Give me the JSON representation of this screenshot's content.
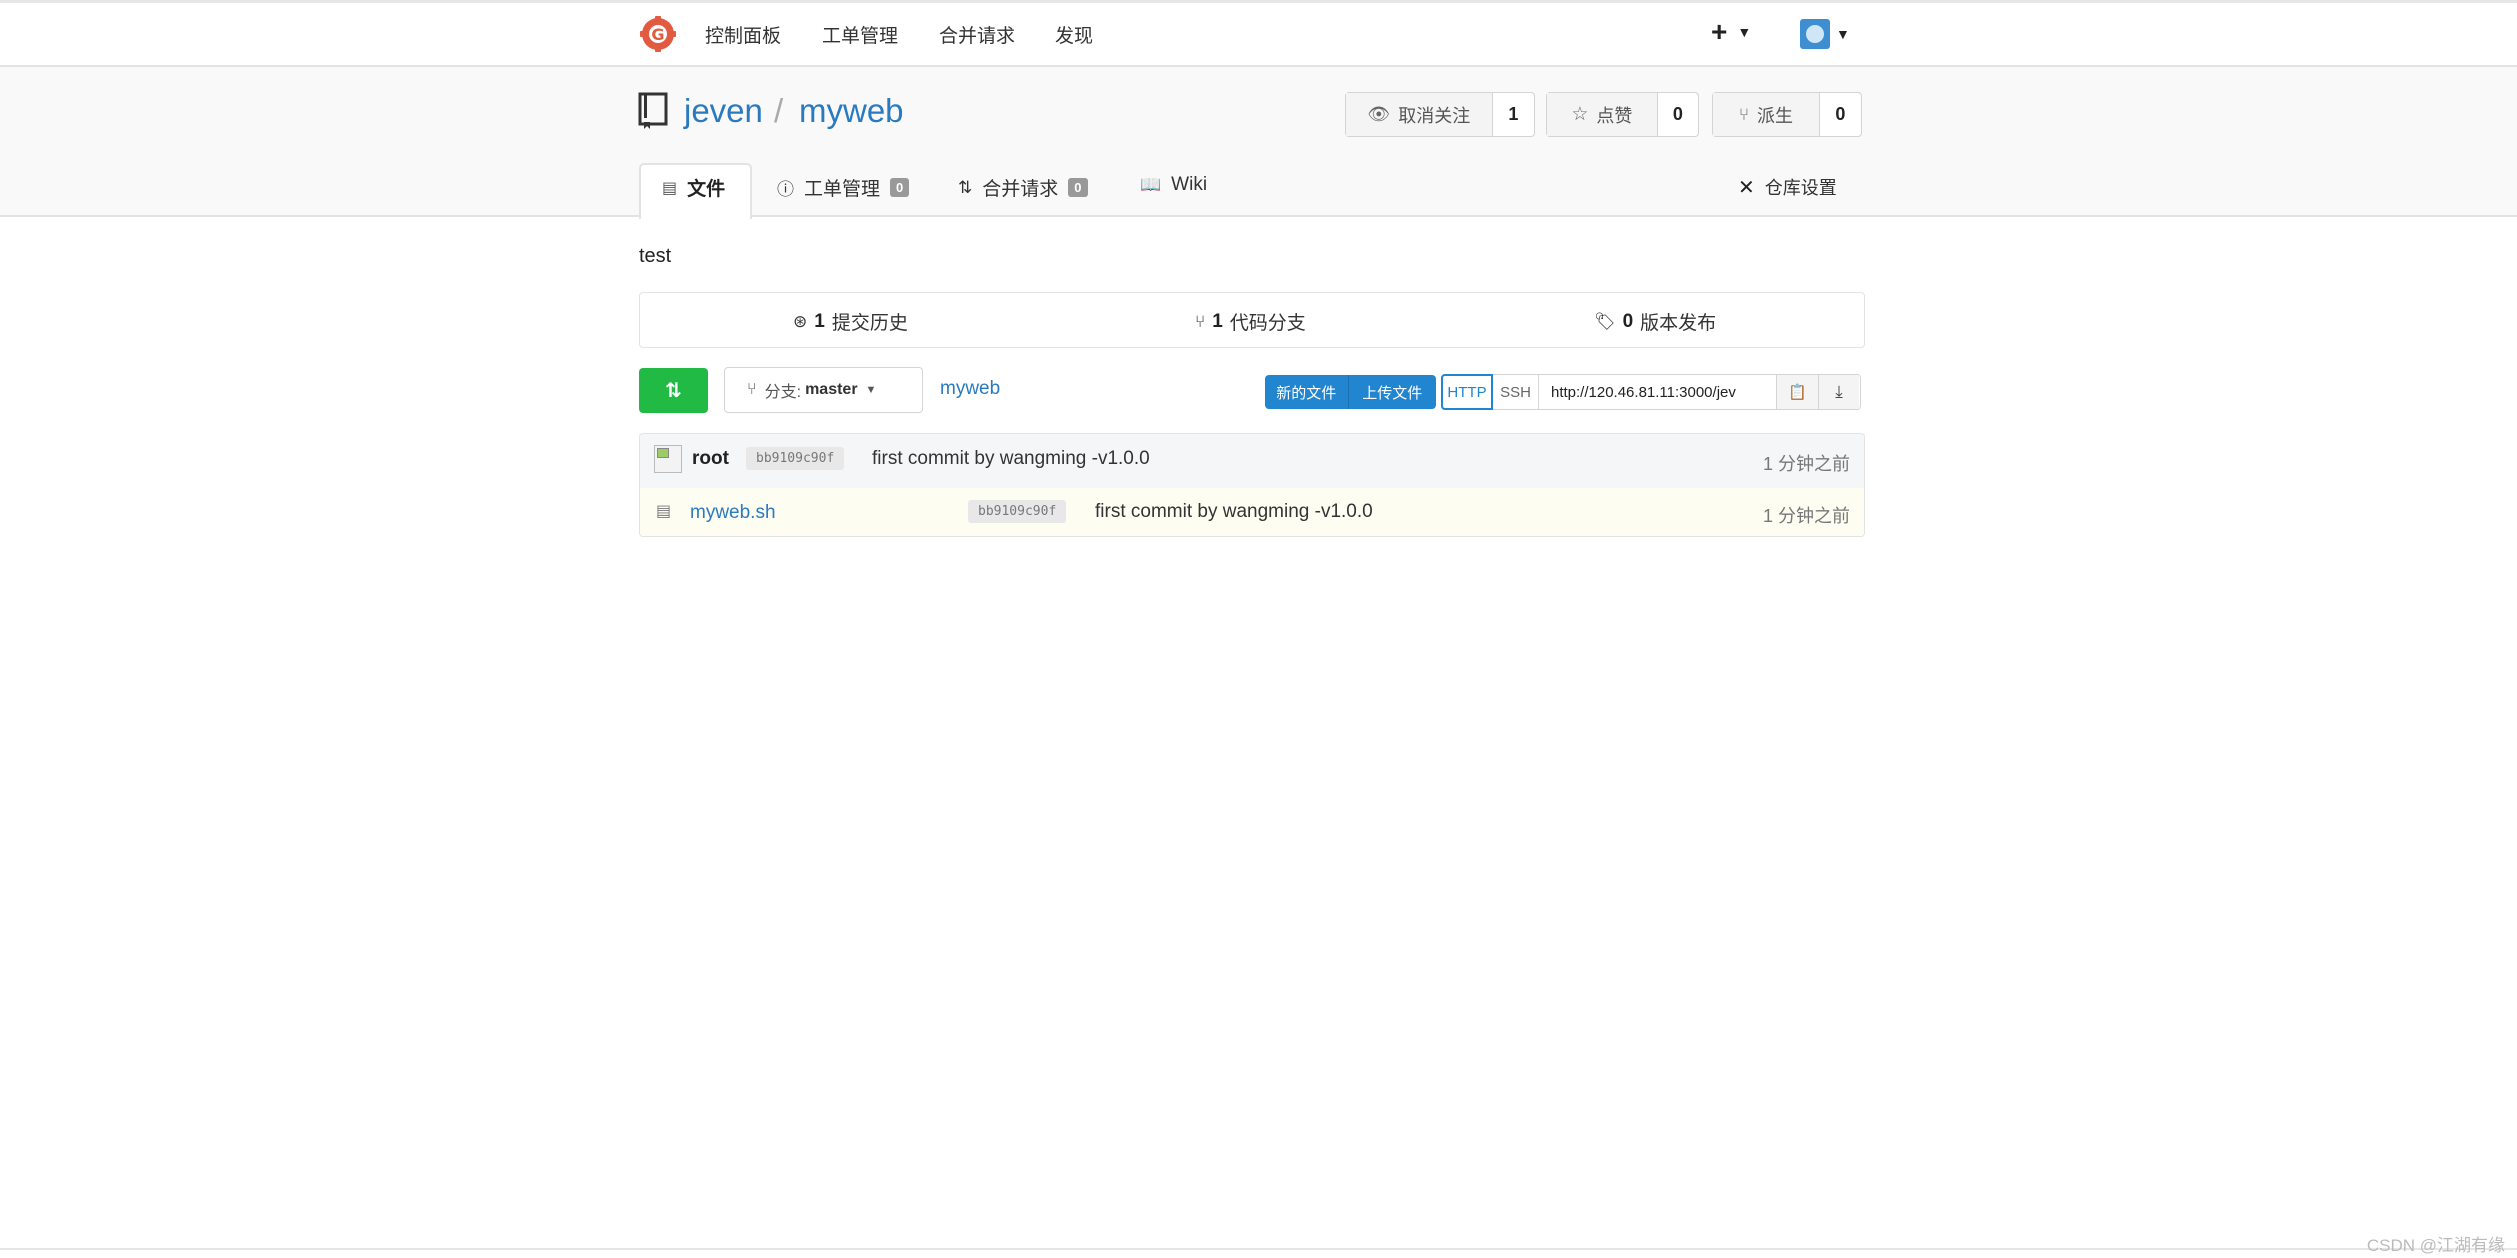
{
  "nav": {
    "items": [
      "控制面板",
      "工单管理",
      "合并请求",
      "发现"
    ],
    "plus": "+"
  },
  "repo": {
    "owner": "jeven",
    "sep": "/",
    "name": "myweb",
    "watch": {
      "label": "取消关注",
      "count": "1"
    },
    "star": {
      "label": "点赞",
      "count": "0"
    },
    "fork": {
      "label": "派生",
      "count": "0"
    }
  },
  "tabs": [
    {
      "label": "文件"
    },
    {
      "label": "工单管理",
      "badge": "0"
    },
    {
      "label": "合并请求",
      "badge": "0"
    },
    {
      "label": "Wiki"
    }
  ],
  "settings_label": "仓库设置",
  "description": "test",
  "stats": {
    "commits": {
      "count": "1",
      "label": "提交历史"
    },
    "branches": {
      "count": "1",
      "label": "代码分支"
    },
    "releases": {
      "count": "0",
      "label": "版本发布"
    }
  },
  "toolbar": {
    "branch_prefix": "分支:",
    "branch": "master",
    "path": "myweb",
    "new_file": "新的文件",
    "upload_file": "上传文件",
    "http": "HTTP",
    "ssh": "SSH",
    "clone_url": "http://120.46.81.11:3000/jev"
  },
  "latest_commit": {
    "author": "root",
    "sha": "bb9109c90f",
    "message": "first commit by wangming -v1.0.0",
    "time": "1 分钟之前"
  },
  "files": [
    {
      "name": "myweb.sh",
      "sha": "bb9109c90f",
      "message": "first commit by wangming -v1.0.0",
      "time": "1 分钟之前"
    }
  ],
  "watermark": "CSDN @江湖有缘",
  "colors": {
    "accent": "#2a7ac0",
    "green": "#21ba45",
    "blue": "#2185d0",
    "logo": "#e25a3f"
  }
}
